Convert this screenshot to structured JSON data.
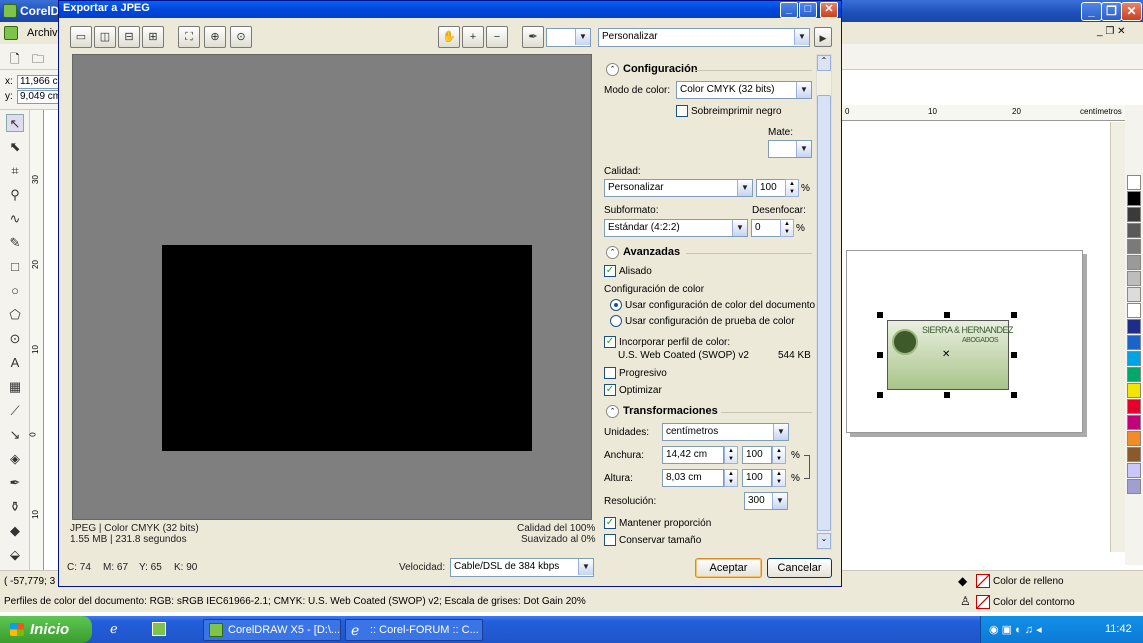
{
  "app": {
    "title": "CorelDR",
    "menu_first": "Archivo",
    "coord_x_label": "x:",
    "coord_x_value": "11,966 c",
    "coord_y_label": "y:",
    "coord_y_value": "9,049 cm",
    "ruler_v": [
      "30",
      "20",
      "10",
      "0",
      "10"
    ],
    "ruler_v_unit": "centímetros",
    "ruler_h": [
      "0",
      "10",
      "20"
    ],
    "ruler_h_unit": "centímetros",
    "card_text_1": "SIERRA & HERNANDEZ",
    "card_text_2": "ABOGADOS",
    "fill_label": "Color de relleno",
    "outline_label": "Color del contorno",
    "cursor_pos": "( -57,779; 3",
    "status_line": "Perfiles de color del documento: RGB: sRGB IEC61966-2.1; CMYK: U.S. Web Coated (SWOP) v2; Escala de grises: Dot Gain 20%",
    "palette": [
      "#ffffff",
      "#000000",
      "#3a3a3a",
      "#5a5a5a",
      "#7a7a7a",
      "#9a9a9a",
      "#bdbdbd",
      "#dcdcdc",
      "#ffffff",
      "#1f2d8a",
      "#1a63c9",
      "#00a4e4",
      "#00a86b",
      "#f2e500",
      "#e4002b",
      "#c2007a",
      "#f28c28",
      "#8a5a2b",
      "#c8c8ff",
      "#a0a0d0"
    ]
  },
  "taskbar": {
    "start": "Inicio",
    "tasks": [
      "CorelDRAW X5 - [D:\\...",
      ":: Corel-FORUM :: C..."
    ],
    "clock": "11:42"
  },
  "dialog": {
    "title": "Exportar a JPEG",
    "preset": "Personalizar",
    "preview_info_left_1": "JPEG  |  Color CMYK (32 bits)",
    "preview_info_left_2": "1.55 MB  |  231.8 segundos",
    "preview_info_right_1": "Calidad del 100%",
    "preview_info_right_2": "Suavizado al 0%",
    "cmyk": {
      "c": "C: 74",
      "m": "M: 67",
      "y": "Y: 65",
      "k": "K: 90"
    },
    "speed_label": "Velocidad:",
    "speed_value": "Cable/DSL de 384 kbps",
    "accept": "Aceptar",
    "cancel": "Cancelar",
    "config": {
      "header": "Configuración",
      "color_mode_label": "Modo de color:",
      "color_mode_value": "Color CMYK (32 bits)",
      "overprint_label": "Sobreimprimir negro",
      "matte_label": "Mate:",
      "quality_label": "Calidad:",
      "quality_value": "Personalizar",
      "quality_number": "100",
      "percent": "%",
      "subformat_label": "Subformato:",
      "subformat_value": "Estándar (4:2:2)",
      "blur_label": "Desenfocar:",
      "blur_value": "0"
    },
    "advanced": {
      "header": "Avanzadas",
      "antialias_label": "Alisado",
      "color_config_label": "Configuración de color",
      "radio_1": "Usar configuración de color del documento",
      "radio_2": "Usar configuración de prueba de color",
      "embed_profile_label": "Incorporar perfil de color:",
      "profile_name": "U.S. Web Coated (SWOP) v2",
      "profile_size": "544 KB",
      "progressive_label": "Progresivo",
      "optimize_label": "Optimizar"
    },
    "transform": {
      "header": "Transformaciones",
      "units_label": "Unidades:",
      "units_value": "centímetros",
      "width_label": "Anchura:",
      "width_value": "14,42 cm",
      "width_pct": "100",
      "height_label": "Altura:",
      "height_value": "8,03 cm",
      "height_pct": "100",
      "resolution_label": "Resolución:",
      "resolution_value": "300",
      "keep_ratio_label": "Mantener proporción",
      "keep_size_label": "Conservar tamaño"
    }
  }
}
